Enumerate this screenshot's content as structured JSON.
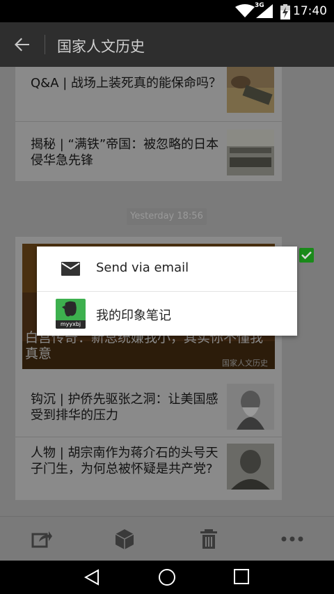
{
  "status_bar": {
    "time": "17:40",
    "network": "3G",
    "icons": [
      "wifi-icon",
      "cell-signal-icon",
      "battery-charging-icon"
    ]
  },
  "app_bar": {
    "title": "国家人文历史",
    "back_icon": "arrow-left-icon"
  },
  "articles_top": [
    {
      "title": "Q&A | 战场上装死真的能保命吗？"
    },
    {
      "title": "揭秘 | “满铁”帝国：被忽略的日本侵华急先锋"
    }
  ],
  "timestamp": "Yesterday 18:56",
  "featured": {
    "caption": "白宫传奇：新总统嫌我小，其实你不懂我真意",
    "watermark": "国家人文历史"
  },
  "articles_bottom": [
    {
      "title": "钩沉 | 护侨先驱张之洞：让美国感受到排华的压力"
    },
    {
      "title": "人物 | 胡宗南作为蒋介石的头号天子门生，为何总被怀疑是共产党?"
    }
  ],
  "share_dialog": {
    "items": [
      {
        "label": "Send via email",
        "icon": "mail-icon"
      },
      {
        "label": "我的印象笔记",
        "icon": "evernote-icon",
        "icon_caption": "myyxbj"
      }
    ]
  },
  "toolbar": {
    "icons": [
      "share-icon",
      "box-icon",
      "trash-icon",
      "more-icon"
    ]
  },
  "nav_bar": {
    "icons": [
      "back-nav-icon",
      "home-nav-icon",
      "recents-nav-icon"
    ]
  },
  "colors": {
    "evernote_green": "#3db04e",
    "check_green": "#1a8a1a",
    "app_bar": "#2e2e2e"
  }
}
